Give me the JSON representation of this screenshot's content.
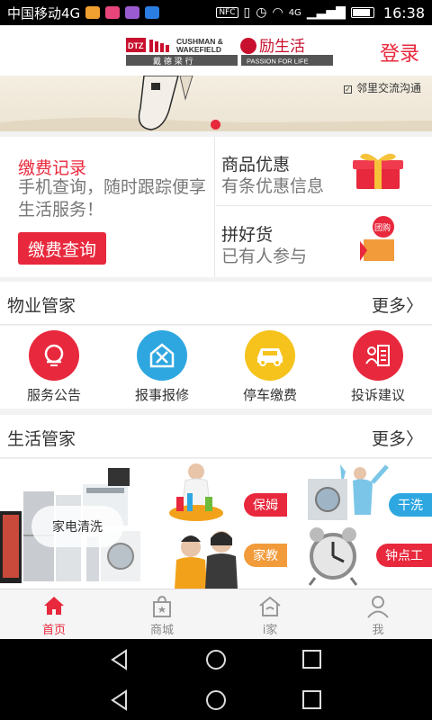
{
  "status": {
    "carrier": "中国移动4G",
    "network": "4G",
    "nfc": "NFC",
    "time": "16:38"
  },
  "header": {
    "logo_top": "CUSHMAN &",
    "logo_bottom": "WAKEFIELD",
    "logo_cn": "戴 德 梁 行",
    "brand_cn": "励生活",
    "slogan": "PASSION FOR LIFE",
    "brand_mark": "DTZ",
    "login": "登录"
  },
  "banner": {
    "check_text": "邻里交流沟通",
    "check_mark": "✓"
  },
  "promo": {
    "title": "缴费记录",
    "desc": "手机查询，随时跟踪便享生活服务！",
    "button": "缴费查询",
    "goods_title": "商品优惠",
    "goods_sub": "有条优惠信息",
    "group_title": "拼好货",
    "group_sub": "已有人参与",
    "group_tag": "团购"
  },
  "property": {
    "title": "物业管家",
    "more": "更多〉",
    "items": [
      {
        "label": "服务公告",
        "color": "#e8283c",
        "icon": "bell-icon"
      },
      {
        "label": "报事报修",
        "color": "#2ea7e0",
        "icon": "repair-tools-icon"
      },
      {
        "label": "停车缴费",
        "color": "#f5c31c",
        "icon": "car-icon"
      },
      {
        "label": "投诉建议",
        "color": "#e8283c",
        "icon": "complaint-icon"
      }
    ]
  },
  "life": {
    "title": "生活管家",
    "more": "更多〉",
    "appliance": "家电清洗",
    "nanny": "保姆",
    "laundry": "干洗",
    "tutor": "家教",
    "hourly": "钟点工"
  },
  "tabs": [
    {
      "label": "首页",
      "icon": "home-icon",
      "active": true
    },
    {
      "label": "商城",
      "icon": "shopping-bag-icon",
      "active": false
    },
    {
      "label": "i家",
      "icon": "house-icon",
      "active": false
    },
    {
      "label": "我",
      "icon": "user-icon",
      "active": false
    }
  ],
  "colors": {
    "accent": "#e8283c",
    "blue": "#2ea7e0",
    "yellow": "#f5c31c"
  }
}
